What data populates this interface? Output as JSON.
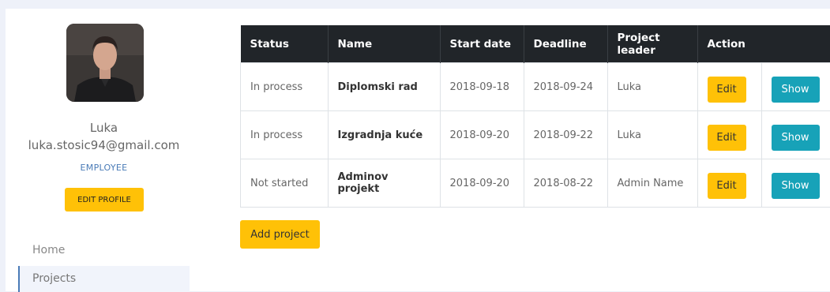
{
  "user": {
    "name": "Luka",
    "email": "luka.stosic94@gmail.com",
    "role": "EMPLOYEE",
    "edit_profile_label": "EDIT PROFILE"
  },
  "nav": {
    "items": [
      {
        "label": "Home"
      },
      {
        "label": "Projects"
      }
    ]
  },
  "table": {
    "headers": [
      "Status",
      "Name",
      "Start date",
      "Deadline",
      "Project leader",
      "Action"
    ],
    "rows": [
      {
        "status": "In process",
        "name": "Diplomski rad",
        "start": "2018-09-18",
        "deadline": "2018-09-24",
        "leader": "Luka",
        "edit": "Edit",
        "show": "Show"
      },
      {
        "status": "In process",
        "name": "Izgradnja kuće",
        "start": "2018-09-20",
        "deadline": "2018-09-22",
        "leader": "Luka",
        "edit": "Edit",
        "show": "Show"
      },
      {
        "status": "Not started",
        "name": "Adminov projekt",
        "start": "2018-09-20",
        "deadline": "2018-08-22",
        "leader": "Admin Name",
        "edit": "Edit",
        "show": "Show"
      }
    ]
  },
  "add_project_label": "Add project",
  "colors": {
    "accent_yellow": "#ffc107",
    "accent_teal": "#17a2b8",
    "header_dark": "#212529",
    "role_blue": "#4a7bb7"
  }
}
